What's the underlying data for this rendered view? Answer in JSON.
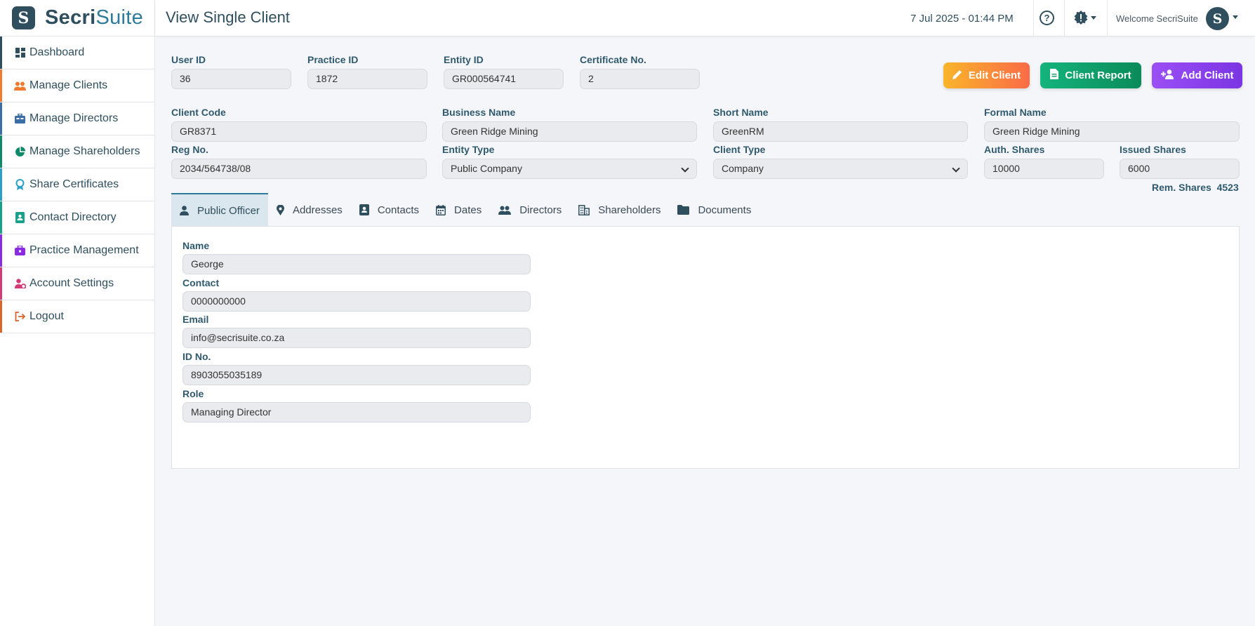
{
  "brand": {
    "part1": "Secri",
    "part2": "Suite",
    "logo_letter": "S"
  },
  "nav": [
    {
      "label": "Dashboard",
      "icon": "dashboard-icon",
      "color": "#2f4f5e"
    },
    {
      "label": "Manage Clients",
      "icon": "users-icon",
      "color": "#f07b2e"
    },
    {
      "label": "Manage Directors",
      "icon": "briefcase-icon",
      "color": "#3a6ea5"
    },
    {
      "label": "Manage Shareholders",
      "icon": "pie-chart-icon",
      "color": "#0e8a6a"
    },
    {
      "label": "Share Certificates",
      "icon": "award-icon",
      "color": "#2aa0c9"
    },
    {
      "label": "Contact Directory",
      "icon": "address-book-icon",
      "color": "#19a08a"
    },
    {
      "label": "Practice Management",
      "icon": "toolbox-icon",
      "color": "#8a2be2"
    },
    {
      "label": "Account Settings",
      "icon": "user-gear-icon",
      "color": "#d43a78"
    },
    {
      "label": "Logout",
      "icon": "logout-icon",
      "color": "#d9652a"
    }
  ],
  "header": {
    "title": "View Single Client",
    "datetime": "7 Jul 2025 - 01:44 PM",
    "help": "?",
    "welcome": "Welcome SecriSuite",
    "avatar_letter": "S"
  },
  "client": {
    "user_id": {
      "label": "User ID",
      "value": "36"
    },
    "practice_id": {
      "label": "Practice ID",
      "value": "1872"
    },
    "entity_id": {
      "label": "Entity ID",
      "value": "GR000564741"
    },
    "certificate_no": {
      "label": "Certificate No.",
      "value": "2"
    },
    "client_code": {
      "label": "Client Code",
      "value": "GR8371"
    },
    "business_name": {
      "label": "Business Name",
      "value": "Green Ridge Mining"
    },
    "short_name": {
      "label": "Short Name",
      "value": "GreenRM"
    },
    "formal_name": {
      "label": "Formal Name",
      "value": "Green Ridge Mining"
    },
    "reg_no": {
      "label": "Reg No.",
      "value": "2034/564738/08"
    },
    "entity_type": {
      "label": "Entity Type",
      "value": "Public Company"
    },
    "client_type": {
      "label": "Client Type",
      "value": "Company"
    },
    "auth_shares": {
      "label": "Auth. Shares",
      "value": "10000"
    },
    "issued_shares": {
      "label": "Issued Shares",
      "value": "6000"
    },
    "rem_shares": {
      "label": "Rem. Shares",
      "value": "4523"
    }
  },
  "buttons": {
    "edit": "Edit Client",
    "report": "Client Report",
    "add": "Add Client"
  },
  "tabs": [
    {
      "label": "Public Officer",
      "icon": "person-icon",
      "active": true
    },
    {
      "label": "Addresses",
      "icon": "location-pin-icon"
    },
    {
      "label": "Contacts",
      "icon": "contact-card-icon"
    },
    {
      "label": "Dates",
      "icon": "calendar-icon"
    },
    {
      "label": "Directors",
      "icon": "users-icon"
    },
    {
      "label": "Shareholders",
      "icon": "building-icon"
    },
    {
      "label": "Documents",
      "icon": "folder-icon"
    }
  ],
  "public_officer": {
    "name": {
      "label": "Name",
      "value": "George"
    },
    "contact": {
      "label": "Contact",
      "value": "0000000000"
    },
    "email": {
      "label": "Email",
      "value": "info@secrisuite.co.za"
    },
    "id_no": {
      "label": "ID No.",
      "value": "8903055035189"
    },
    "role": {
      "label": "Role",
      "value": "Managing Director"
    }
  }
}
